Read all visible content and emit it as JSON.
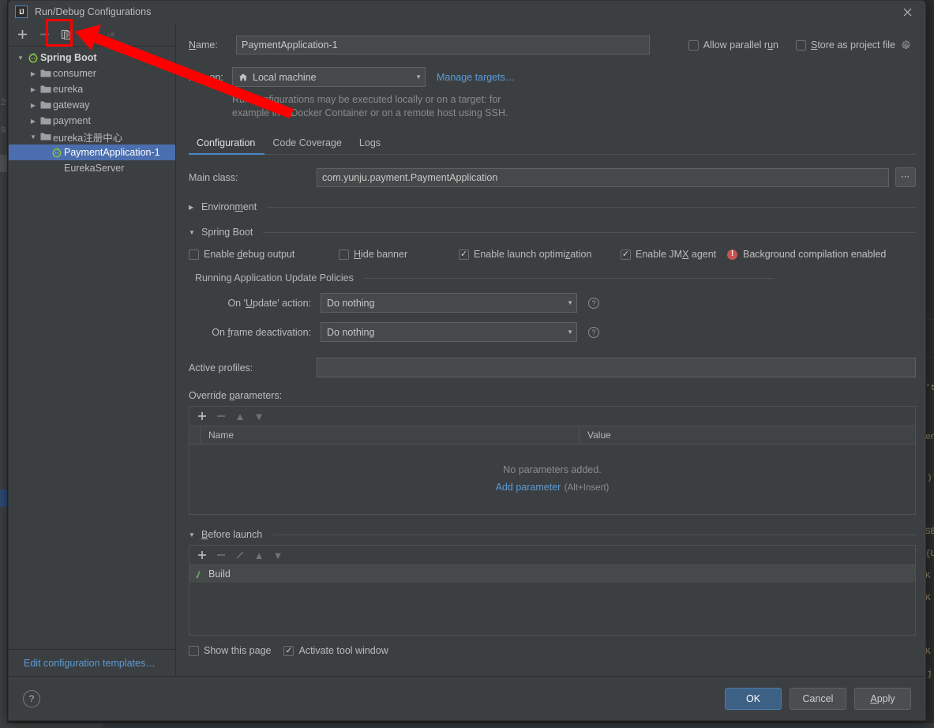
{
  "window": {
    "title": "Run/Debug Configurations",
    "logo_text": "IJ",
    "close_icon": "close-icon"
  },
  "sidebar": {
    "toolbar": [
      {
        "name": "add-configuration-button",
        "glyph": "+",
        "enabled": true
      },
      {
        "name": "remove-configuration-button",
        "glyph": "−",
        "enabled": false
      },
      {
        "name": "copy-configuration-button",
        "glyph": "copy-icon",
        "enabled": true
      },
      {
        "name": "move-into-folder-button",
        "glyph": "folder-icon",
        "enabled": false
      },
      {
        "name": "sort-configurations-button",
        "glyph": "sort-az-icon",
        "enabled": false
      }
    ],
    "tree": [
      {
        "label": "Spring Boot",
        "indent": 0,
        "arrow": "expanded",
        "icon": "spring-boot-icon",
        "bold": true,
        "selected": false
      },
      {
        "label": "consumer",
        "indent": 1,
        "arrow": "collapsed",
        "icon": "folder-icon",
        "bold": false,
        "selected": false
      },
      {
        "label": "eureka",
        "indent": 1,
        "arrow": "collapsed",
        "icon": "folder-icon",
        "bold": false,
        "selected": false
      },
      {
        "label": "gateway",
        "indent": 1,
        "arrow": "collapsed",
        "icon": "folder-icon",
        "bold": false,
        "selected": false
      },
      {
        "label": "payment",
        "indent": 1,
        "arrow": "collapsed",
        "icon": "folder-icon",
        "bold": false,
        "selected": false
      },
      {
        "label": "eureka注册中心",
        "indent": 1,
        "arrow": "expanded",
        "icon": "folder-icon",
        "bold": false,
        "selected": false
      },
      {
        "label": "PaymentApplication-1",
        "indent": 2,
        "arrow": "none",
        "icon": "spring-boot-icon",
        "bold": false,
        "selected": true
      },
      {
        "label": "EurekaServer",
        "indent": 2,
        "arrow": "none",
        "icon": "none",
        "bold": false,
        "selected": false
      }
    ],
    "edit_templates_link": "Edit configuration templates…"
  },
  "form": {
    "name_label": "Name:",
    "name_value": "PaymentApplication-1",
    "allow_parallel_run": {
      "label": "Allow parallel run",
      "checked": false
    },
    "store_as_project_file": {
      "label": "Store as project file",
      "checked": false
    },
    "gear_icon": "gear-icon",
    "run_on_label": "Run on:",
    "run_on_value": "Local machine",
    "manage_targets_link": "Manage targets…",
    "hint_line1": "Run configurations may be executed locally or on a target: for",
    "hint_line2": "example in a Docker Container or on a remote host using SSH.",
    "tabs": [
      {
        "label": "Configuration",
        "active": true
      },
      {
        "label": "Code Coverage",
        "active": false
      },
      {
        "label": "Logs",
        "active": false
      }
    ],
    "main_class_label": "Main class:",
    "main_class_value": "com.yunju.payment.PaymentApplication",
    "browse_button": "…",
    "environment_group": {
      "label": "Environment",
      "expanded": false
    },
    "spring_boot_group": {
      "label": "Spring Boot",
      "expanded": true
    },
    "spring_checks": [
      {
        "label": "Enable debug output",
        "checked": false
      },
      {
        "label": "Hide banner",
        "checked": false
      },
      {
        "label": "Enable launch optimization",
        "checked": true
      },
      {
        "label": "Enable JMX agent",
        "checked": true
      }
    ],
    "background_warning": "Background compilation enabled",
    "update_policies_label": "Running Application Update Policies",
    "on_update_label": "On 'Update' action:",
    "on_update_value": "Do nothing",
    "on_frame_label": "On frame deactivation:",
    "on_frame_value": "Do nothing",
    "active_profiles_label": "Active profiles:",
    "active_profiles_value": "",
    "override_params_label": "Override parameters:",
    "param_table": {
      "columns": [
        "Name",
        "Value"
      ],
      "rows": [],
      "empty_message": "No parameters added.",
      "add_link": "Add parameter",
      "add_hint": "(Alt+Insert)"
    },
    "before_launch_group": {
      "label": "Before launch",
      "expanded": true
    },
    "before_launch_items": [
      {
        "label": "Build",
        "icon": "build-wrench-icon"
      }
    ],
    "show_this_page": {
      "label": "Show this page",
      "checked": false
    },
    "activate_tool_window": {
      "label": "Activate tool window",
      "checked": true
    }
  },
  "footer": {
    "help_label": "?",
    "ok_label": "OK",
    "cancel_label": "Cancel",
    "apply_label": "Apply"
  },
  "annotations": {
    "highlight_target": "copy-configuration-button",
    "arrow_color": "#ff0000",
    "box_color": "#ff0000"
  },
  "background_ide": {
    "right_fragments": [
      "'t",
      "en",
      ")",
      "SE",
      "{U",
      "K",
      "K",
      "K",
      "j"
    ],
    "left_fragments": [
      "2",
      "9"
    ]
  }
}
